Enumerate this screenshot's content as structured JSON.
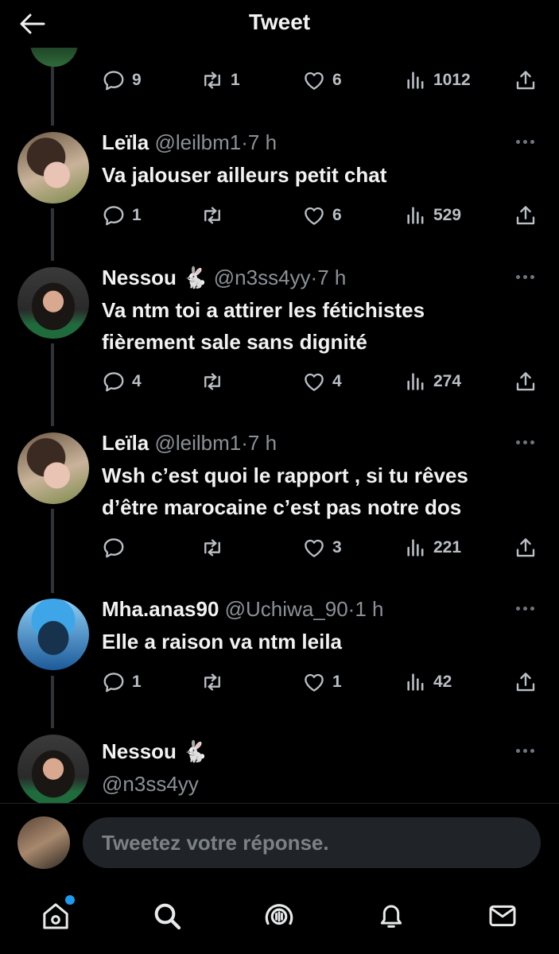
{
  "header": {
    "title": "Tweet",
    "back_icon": "arrow-left-icon"
  },
  "first_tweet_actions": {
    "replies": "9",
    "retweets": "1",
    "likes": "6",
    "views": "1012"
  },
  "tweets": [
    {
      "name": "Leïla",
      "handle": "@leilbm1",
      "dot": "·",
      "time": "7 h",
      "text": "Va jalouser ailleurs petit chat",
      "replies": "1",
      "retweets": "",
      "likes": "6",
      "views": "529"
    },
    {
      "name": "Nessou 🐇",
      "handle": "@n3ss4yy",
      "dot": "·",
      "time": "7 h",
      "text_line1": "Va ntm toi a attirer les fétichistes",
      "text_line2": "fièrement sale sans dignité",
      "replies": "4",
      "retweets": "",
      "likes": "4",
      "views": "274"
    },
    {
      "name": "Leïla",
      "handle": "@leilbm1",
      "dot": "·",
      "time": "7 h",
      "text_line1": "Wsh c’est quoi le rapport , si tu rêves",
      "text_line2": "d’être marocaine c’est pas notre dos",
      "replies": "",
      "retweets": "",
      "likes": "3",
      "views": "221"
    },
    {
      "name": "Mha.anas90",
      "handle": "@Uchiwa_90",
      "dot": "·",
      "time": "1 h",
      "text": "Elle a raison va ntm leila",
      "replies": "1",
      "retweets": "",
      "likes": "1",
      "views": "42"
    },
    {
      "name": "Nessou 🐇",
      "handle": "@n3ss4yy"
    }
  ],
  "reply_box": {
    "placeholder": "Tweetez votre réponse."
  },
  "bottom_nav": {
    "items": [
      "home-icon",
      "search-icon",
      "spaces-icon",
      "notifications-icon",
      "messages-icon"
    ],
    "home_has_badge": true,
    "badge_color": "#1d9bf0"
  },
  "colors": {
    "background": "#000000",
    "text": "#e7e9ea",
    "muted": "#8b9196",
    "accent": "#1d9bf0"
  }
}
